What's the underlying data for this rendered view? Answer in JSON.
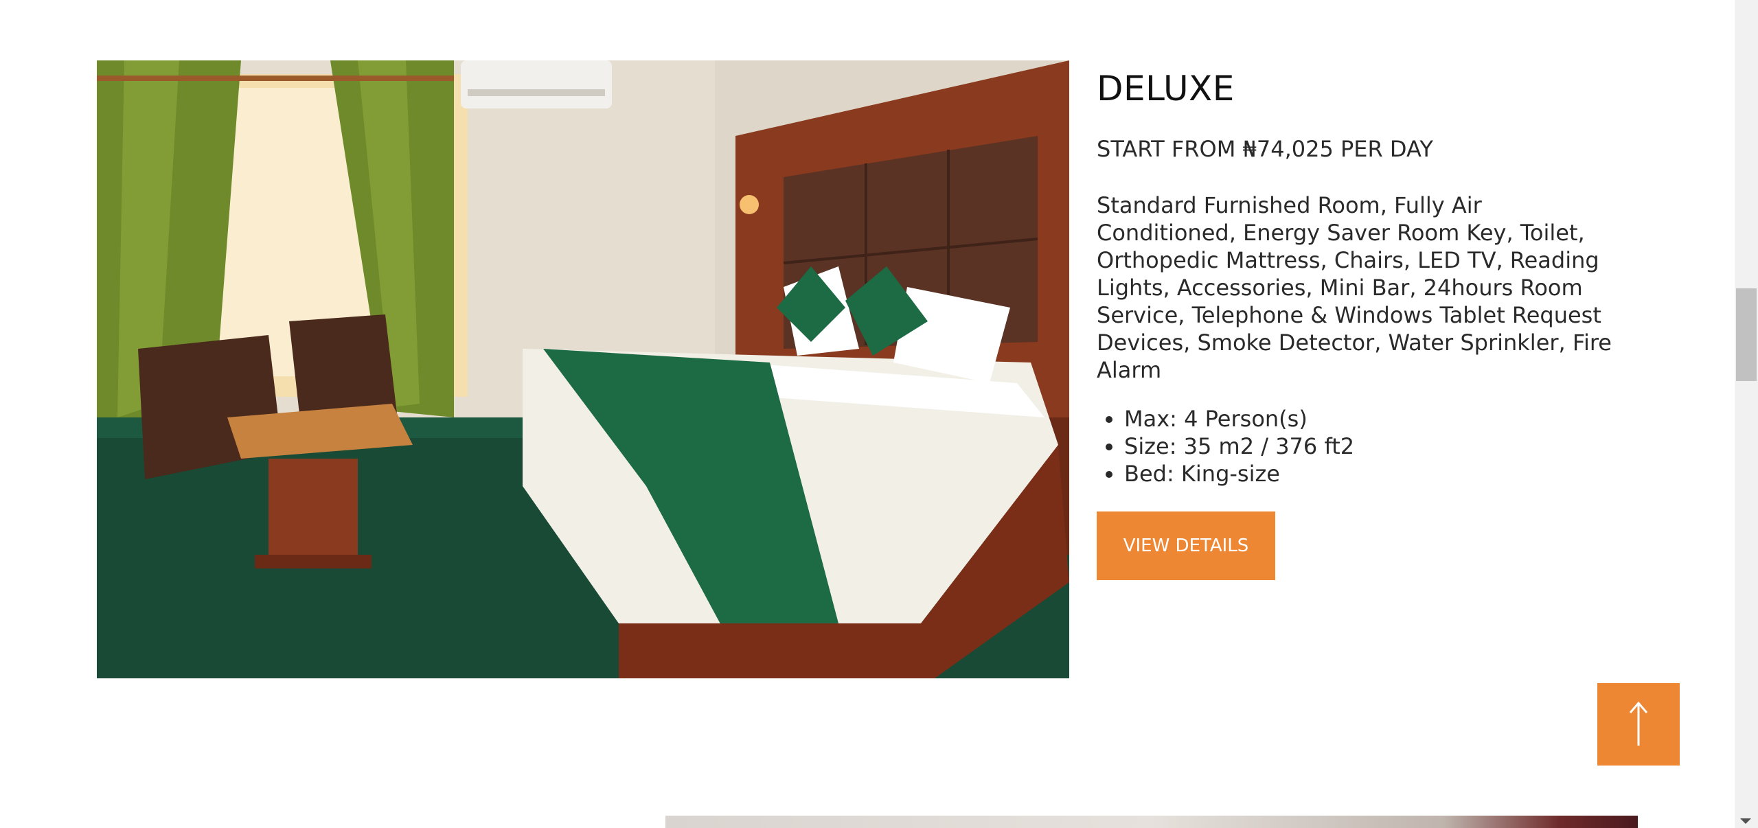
{
  "room": {
    "title": "DELUXE",
    "price": "START FROM ₦74,025 PER DAY",
    "description": "Standard Furnished Room, Fully Air Conditioned, Energy Saver Room Key, Toilet, Orthopedic Mattress, Chairs, LED TV, Reading Lights, Accessories, Mini Bar, 24hours Room Service, Telephone & Windows Tablet Request Devices, Smoke Detector, Water Sprinkler, Fire Alarm",
    "features": [
      "Max: 4 Person(s)",
      "Size: 35 m2 / 376 ft2",
      "Bed: King-size"
    ],
    "button_label": "VIEW DETAILS"
  },
  "back_to_top_icon": "arrow-up-icon",
  "colors": {
    "accent": "#ee8733",
    "background": "#ffffff",
    "text": "#2a2a2a"
  }
}
